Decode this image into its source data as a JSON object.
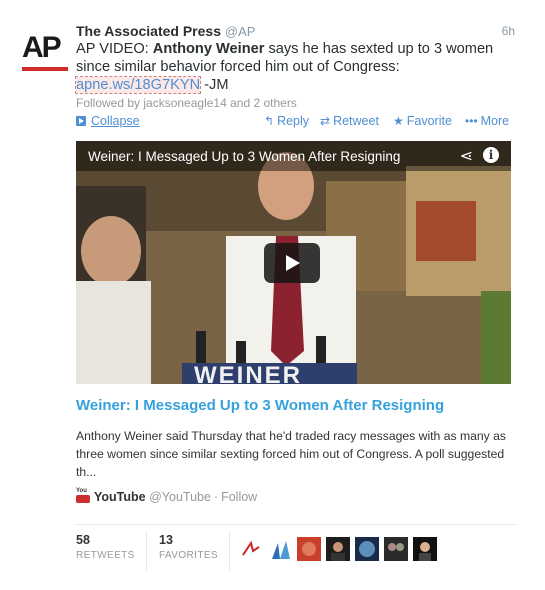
{
  "tweet": {
    "author_name": "The Associated Press",
    "handle": "@AP",
    "time": "6h",
    "avatar_text": "AP",
    "text_prefix": "AP VIDEO: ",
    "text_bold": "Anthony Weiner",
    "text_middle": " says he has sexted up to 3 women since similar behavior forced him out of Congress: ",
    "link_text": "apne.ws/18G7KYN",
    "text_suffix": " -JM",
    "followed_by": "Followed by jacksoneagle14 and 2 others"
  },
  "actions": {
    "collapse": "Collapse",
    "reply": "Reply",
    "retweet": "Retweet",
    "favorite": "Favorite",
    "more": "More"
  },
  "video": {
    "title": "Weiner: I Messaged Up to 3 Women After Resigning",
    "sign_text": "WEINER",
    "share_icon": "share-icon",
    "info_icon": "info-icon",
    "play_icon": "play-icon"
  },
  "card": {
    "title": "Weiner: I Messaged Up to 3 Women After Resigning",
    "description": "Anthony Weiner said Thursday that he'd traded racy messages with as many as three women since similar sexting forced him out of Congress. A poll suggested th...",
    "source_name": "YouTube",
    "source_handle": "@YouTube",
    "separator": "·",
    "follow": "Follow"
  },
  "stats": {
    "retweets": "58",
    "retweets_label": "RETWEETS",
    "favorites": "13",
    "favorites_label": "FAVORITES"
  },
  "colors": {
    "link": "#4f8fd1",
    "card_title": "#35a2dc",
    "ap_red": "#d02c2c",
    "youtube_red": "#cc2d2d"
  }
}
